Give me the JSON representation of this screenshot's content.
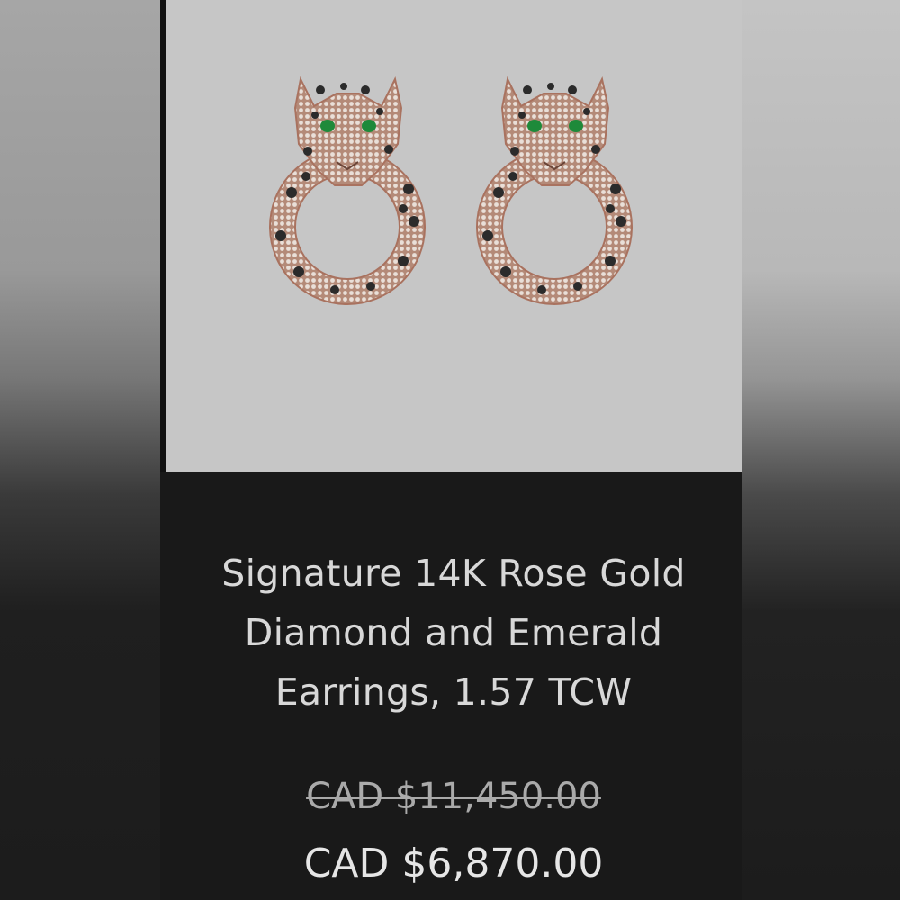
{
  "product": {
    "image_icon": "leopard-earrings-image",
    "title_line1": "Signature 14K Rose Gold",
    "title_line2": "Diamond and Emerald",
    "title_line3": "Earrings, 1.57 TCW",
    "original_price": "CAD $11,450.00",
    "sale_price": "CAD $6,870.00"
  },
  "colors": {
    "image_background": "#c6c6c6",
    "card_background": "#191919",
    "metal": "#b88b78",
    "emerald": "#1e8a3a",
    "spots": "#2b2b2b"
  }
}
